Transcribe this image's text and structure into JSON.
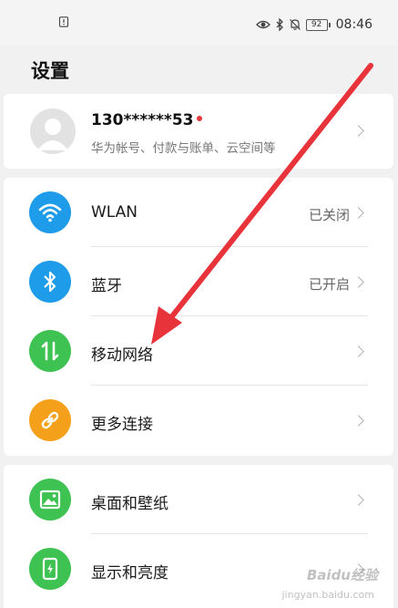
{
  "status_bar": {
    "time": "08:46",
    "battery": "92",
    "left_icon": "sim-alert-icon",
    "right_icons": [
      "eye-comfort-icon",
      "bluetooth-icon",
      "mute-bell-icon",
      "battery-icon"
    ]
  },
  "page": {
    "title": "设置"
  },
  "account": {
    "name": "130******53",
    "subtitle": "华为帐号、付款与账单、云空间等",
    "avatar_icon": "user-avatar-icon"
  },
  "items": [
    {
      "label": "WLAN",
      "value": "已关闭",
      "icon": "wifi-icon",
      "color": "#1e9be9"
    },
    {
      "label": "蓝牙",
      "value": "已开启",
      "icon": "bluetooth-icon",
      "color": "#1e9be9"
    },
    {
      "label": "移动网络",
      "value": "",
      "icon": "mobile-data-icon",
      "color": "#3ec251"
    },
    {
      "label": "更多连接",
      "value": "",
      "icon": "link-icon",
      "color": "#f5a01a"
    },
    {
      "label": "桌面和壁纸",
      "value": "",
      "icon": "wallpaper-icon",
      "color": "#3ec251"
    },
    {
      "label": "显示和亮度",
      "value": "",
      "icon": "display-icon",
      "color": "#3ec251"
    }
  ],
  "watermark": {
    "text": "Baidu经验",
    "sub": "jingyan.baidu.com"
  },
  "colors": {
    "annotation_arrow": "#e8333b",
    "accent_blue": "#1e9be9",
    "accent_green": "#3ec251",
    "accent_orange": "#f5a01a"
  }
}
